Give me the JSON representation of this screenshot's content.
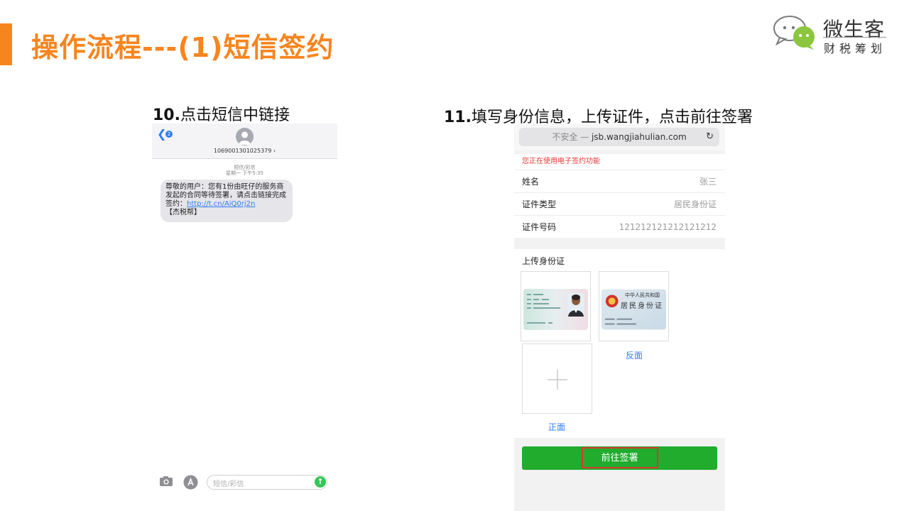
{
  "slide": {
    "title": "操作流程---(1)短信签约",
    "accent_color": "#f7851e"
  },
  "logo": {
    "name": "微生客",
    "subtitle": "财税筹划"
  },
  "step10": {
    "number": "10.",
    "text": "点击短信中链接"
  },
  "step11": {
    "number": "11.",
    "text": "填写身份信息，上传证件，点击前往签署"
  },
  "sms": {
    "back_badge": "2",
    "sender_number": "1069001301025379 ›",
    "meta_type": "短信/彩信",
    "meta_time": "星期一 下午5:35",
    "message_part1": "尊敬的用户：您有1份由旺仔的服务商发起的合同等待签署，请点击链接完成签约：",
    "message_link": "http://t.cn/AiQ0rj2n",
    "message_part2": "【杰税帮】",
    "input_placeholder": "短信/彩信"
  },
  "form": {
    "url_insecure": "不安全 —",
    "url_domain": "jsb.wangjiahulian.com",
    "notice": "您正在使用电子签约功能",
    "fields": [
      {
        "label": "姓名",
        "value": "张三"
      },
      {
        "label": "证件类型",
        "value": "居民身份证"
      },
      {
        "label": "证件号码",
        "value": "121212121212121212"
      }
    ],
    "upload_label": "上传身份证",
    "id_back_title1": "中华人民共和国",
    "id_back_title2": "居民身份证",
    "caption_back": "反面",
    "caption_front": "正面",
    "submit_label": "前往签署"
  },
  "colors": {
    "accent": "#f7851e",
    "link": "#2f7cf6",
    "primary_button": "#21ac2e",
    "notice": "#e53935",
    "highlight": "#d93a2b"
  }
}
